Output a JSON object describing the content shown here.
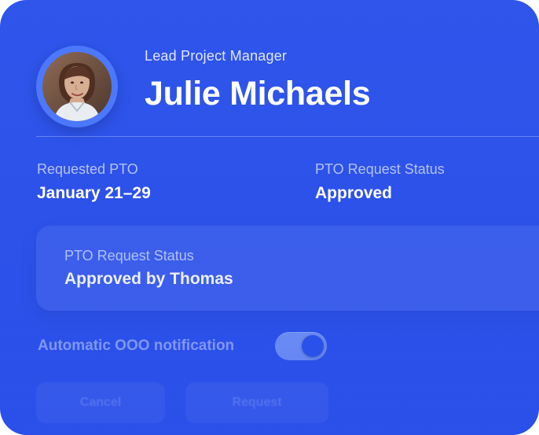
{
  "profile": {
    "role": "Lead Project Manager",
    "name": "Julie Michaels"
  },
  "details": {
    "requested_label": "Requested PTO",
    "requested_value": "January 21–29",
    "status_label": "PTO Request Status",
    "status_value": "Approved"
  },
  "panel": {
    "label": "PTO Request Status",
    "value": "Approved by Thomas"
  },
  "notification": {
    "label": "Automatic OOO notification",
    "enabled": true
  },
  "buttons": {
    "first_label": "Cancel",
    "second_label": "Request"
  },
  "colors": {
    "card": "#2f55eb",
    "toggle_track": "#6c8df4",
    "text_primary": "#ffffff"
  }
}
